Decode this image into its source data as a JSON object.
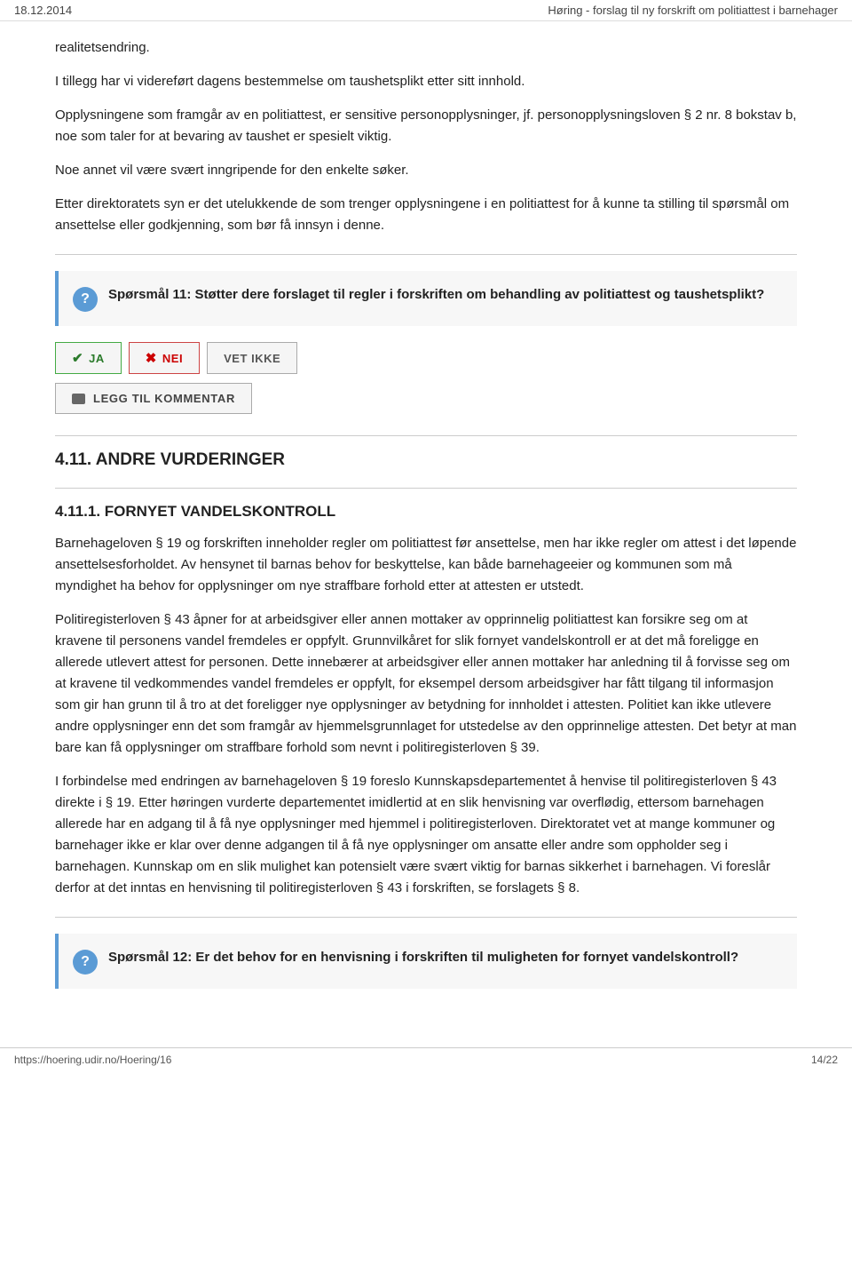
{
  "topbar": {
    "date": "18.12.2014",
    "title": "Høring - forslag til ny forskrift om politiattest i barnehager"
  },
  "content": {
    "paragraphs": [
      "realitetsendring.",
      "I tillegg har vi videreført dagens bestemmelse om taushetsplikt etter sitt innhold.",
      "Opplysningene som framgår av en politiattest, er sensitive personopplysninger, jf. personopplysningsloven § 2 nr. 8 bokstav b, noe som taler for at bevaring av taushet er spesielt viktig.",
      "Noe annet vil være svært inngripende for den enkelte søker.",
      "Etter direktoratets syn er det utelukkende de som trenger opplysningene i en politiattest for å kunne ta stilling til spørsmål om ansettelse eller godkjenning, som bør få innsyn i denne."
    ],
    "question11": {
      "label": "Spørsmål 11: Støtter dere forslaget til regler i forskriften om behandling av politiattest og taushetsplikt?"
    },
    "vote": {
      "ja": "JA",
      "nei": "NEI",
      "vet_ikke": "VET IKKE"
    },
    "comment_button": "LEGG TIL KOMMENTAR",
    "section_4_11": "4.11. ANDRE VURDERINGER",
    "section_4_11_1": "4.11.1. FORNYET VANDELSKONTROLL",
    "fornyet_paragraphs": [
      "Barnehageloven § 19 og forskriften inneholder regler om politiattest før ansettelse, men har ikke regler om attest i det løpende ansettelsesforholdet. Av hensynet til barnas behov for beskyttelse, kan både barnehageeier og kommunen som må myndighet ha behov for opplysninger om nye straffbare forhold etter at attesten er utstedt.",
      "Politiregisterloven § 43 åpner for at arbeidsgiver eller annen mottaker av opprinnelig politiattest kan forsikre seg om at kravene til personens vandel fremdeles er oppfylt. Grunnvilkåret for slik fornyet vandelskontroll er at det må foreligge en allerede utlevert attest for personen. Dette innebærer at arbeidsgiver eller annen mottaker har anledning til å forvisse seg om at kravene til vedkommendes vandel fremdeles er oppfylt, for eksempel dersom arbeidsgiver har fått tilgang til informasjon som gir han grunn til å tro at det foreligger nye opplysninger av betydning for innholdet i attesten. Politiet kan ikke utlevere andre opplysninger enn det som framgår av hjemmelsgrunnlaget for utstedelse av den opprinnelige attesten. Det betyr at man bare kan få opplysninger om straffbare forhold som nevnt i politiregisterloven § 39.",
      "I forbindelse med endringen av barnehageloven § 19 foreslo Kunnskapsdepartementet å henvise til politiregisterloven § 43 direkte i § 19. Etter høringen vurderte departementet imidlertid at en slik henvisning var overflødig, ettersom barnehagen allerede har en adgang til å få nye opplysninger med hjemmel i politiregisterloven. Direktoratet vet at mange kommuner og barnehager ikke er klar over denne adgangen til å få nye opplysninger om ansatte eller andre som oppholder seg i barnehagen. Kunnskap om en slik mulighet kan potensielt være svært viktig for barnas sikkerhet i barnehagen. Vi foreslår derfor at det inntas en henvisning til politiregisterloven § 43 i forskriften, se forslagets § 8."
    ],
    "question12": {
      "label": "Spørsmål 12: Er det behov for en henvisning i forskriften til muligheten for fornyet vandelskontroll?"
    }
  },
  "bottombar": {
    "url": "https://hoering.udir.no/Hoering/16",
    "page": "14/22"
  }
}
